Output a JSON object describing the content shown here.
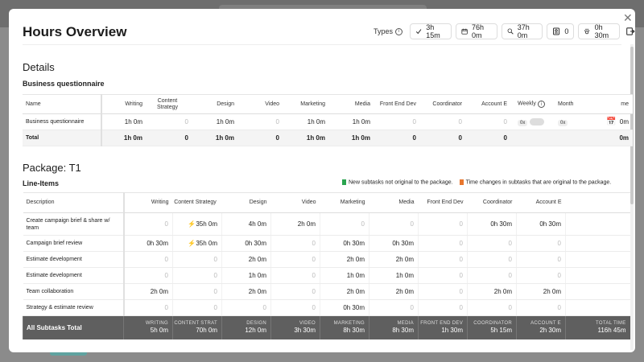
{
  "modal": {
    "title": "Hours Overview",
    "types_label": "Types",
    "pills": [
      {
        "icon": "check-icon",
        "value": "3h 15m"
      },
      {
        "icon": "calendar-icon",
        "value": "76h 0m"
      },
      {
        "icon": "search-icon",
        "value": "37h 0m"
      },
      {
        "icon": "badge-icon",
        "value": "0"
      },
      {
        "icon": "paw-icon",
        "value": "0h 30m"
      }
    ]
  },
  "details": {
    "heading": "Details",
    "subheading": "Business questionnaire",
    "columns": [
      "Name",
      "Writing",
      "Content Strategy",
      "Design",
      "Video",
      "Marketing",
      "Media",
      "Front End Dev",
      "Coordinator",
      "Account E",
      "Weekly",
      "Month",
      "me"
    ],
    "row": {
      "name": "Business questionnaire",
      "values": [
        "1h 0m",
        "0",
        "1h 0m",
        "0",
        "1h 0m",
        "1h 0m",
        "0",
        "0",
        "0"
      ],
      "weekly": "0x",
      "monthly": "0x",
      "time": "0m"
    },
    "total": {
      "name": "Total",
      "values": [
        "1h 0m",
        "0",
        "1h 0m",
        "0",
        "1h 0m",
        "1h 0m",
        "0",
        "0",
        "0"
      ],
      "time": "0m"
    }
  },
  "package": {
    "heading": "Package: T1",
    "subheading": "Line-Items",
    "legend": {
      "new": "New subtasks not original to the package.",
      "changed": "Time changes in subtasks that are original to the package."
    },
    "colors": {
      "new_flag": "#2aa44f",
      "changed_flag": "#e8772e"
    },
    "columns": [
      "Description",
      "Writing",
      "Content Strategy",
      "Design",
      "Video",
      "Marketing",
      "Media",
      "Front End Dev",
      "Coordinator",
      "Account E"
    ],
    "rows": [
      {
        "desc": "Create campaign brief & share w/ team",
        "values": [
          "0",
          "35h 0m",
          "4h 0m",
          "2h 0m",
          "0",
          "0",
          "0",
          "0h 30m",
          "0h 30m"
        ]
      },
      {
        "desc": "Campaign brief review",
        "values": [
          "0h 30m",
          "35h 0m",
          "0h 30m",
          "0",
          "0h 30m",
          "0h 30m",
          "0",
          "0",
          "0"
        ]
      },
      {
        "desc": "Estimate development",
        "values": [
          "0",
          "0",
          "2h 0m",
          "0",
          "2h 0m",
          "2h 0m",
          "0",
          "0",
          "0"
        ]
      },
      {
        "desc": "Estimate development",
        "values": [
          "0",
          "0",
          "1h 0m",
          "0",
          "1h 0m",
          "1h 0m",
          "0",
          "0",
          "0"
        ]
      },
      {
        "desc": "Team collaboration",
        "values": [
          "2h 0m",
          "0",
          "2h 0m",
          "0",
          "2h 0m",
          "2h 0m",
          "0",
          "2h 0m",
          "2h 0m"
        ]
      },
      {
        "desc": "Strategy & estimate review",
        "values": [
          "0",
          "0",
          "0",
          "0",
          "0h 30m",
          "0",
          "0",
          "0",
          "0"
        ]
      }
    ],
    "footer": {
      "label": "All Subtasks Total",
      "cells": [
        {
          "label": "WRITING",
          "value": "5h 0m"
        },
        {
          "label": "CONTENT STRAT",
          "value": "70h 0m"
        },
        {
          "label": "DESIGN",
          "value": "12h 0m"
        },
        {
          "label": "VIDEO",
          "value": "3h 30m"
        },
        {
          "label": "MARKETING",
          "value": "8h 30m"
        },
        {
          "label": "MEDIA",
          "value": "8h 30m"
        },
        {
          "label": "FRONT END DEV",
          "value": "1h 30m"
        },
        {
          "label": "COORDINATOR",
          "value": "5h 15m"
        },
        {
          "label": "ACCOUNT E",
          "value": "2h 30m"
        },
        {
          "label": "TOTAL TIME",
          "value": "116h 45m"
        }
      ]
    }
  }
}
